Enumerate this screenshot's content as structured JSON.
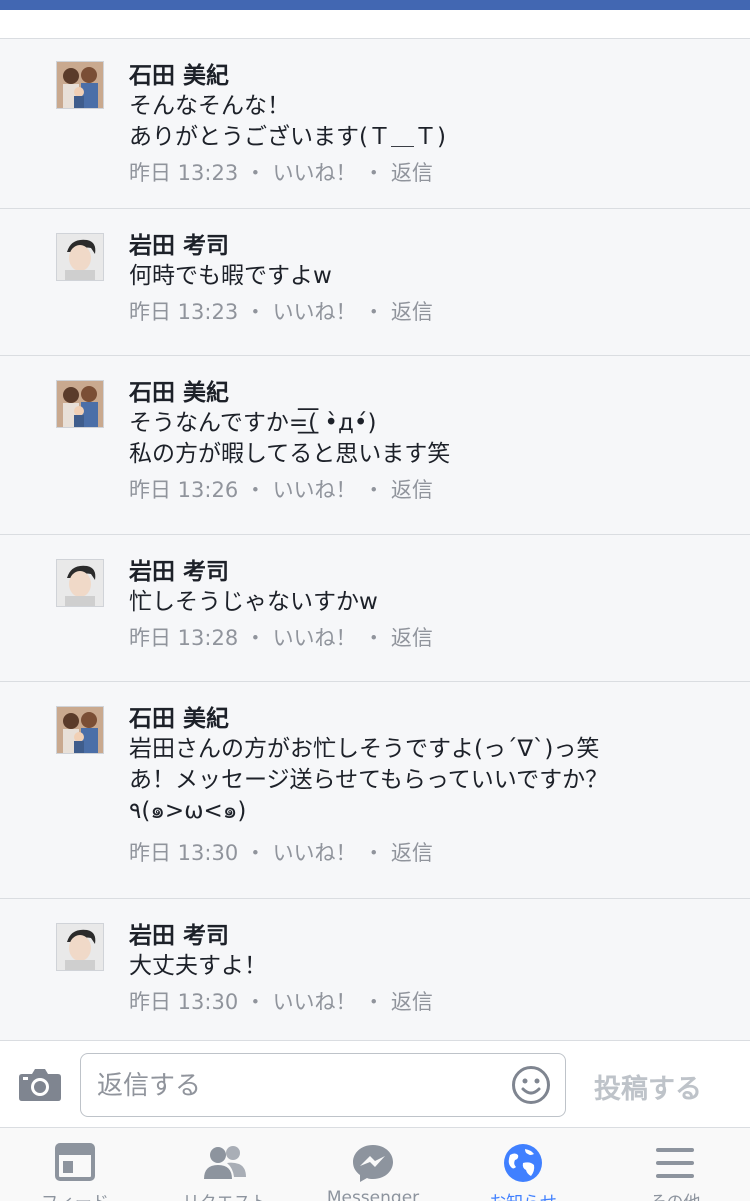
{
  "comments": [
    {
      "name": "石田 美紀",
      "text": "そんなそんな！\nありがとうございます(Ｔ＿Ｔ)",
      "time": "昨日 13:23",
      "like": "いいね！",
      "reply": "返信",
      "avatar": "couple"
    },
    {
      "name": "岩田 考司",
      "text": "何時でも暇ですよw",
      "time": "昨日 13:23",
      "like": "いいね！",
      "reply": "返信",
      "avatar": "man"
    },
    {
      "name": "石田 美紀",
      "text": "そうなんですか=͟͟͞͞( •̀д•́)\n私の方が暇してると思います笑",
      "time": "昨日 13:26",
      "like": "いいね！",
      "reply": "返信",
      "avatar": "couple"
    },
    {
      "name": "岩田 考司",
      "text": "忙しそうじゃないすかw",
      "time": "昨日 13:28",
      "like": "いいね！",
      "reply": "返信",
      "avatar": "man"
    },
    {
      "name": "石田 美紀",
      "text": "岩田さんの方がお忙しそうですよ(っ´∇`)っ笑\nあ！メッセージ送らせてもらっていいですか？\n٩(๑>ω<๑)",
      "time": "昨日 13:30",
      "like": "いいね！",
      "reply": "返信",
      "avatar": "couple"
    },
    {
      "name": "岩田 考司",
      "text": "大丈夫すよ！",
      "time": "昨日 13:30",
      "like": "いいね！",
      "reply": "返信",
      "avatar": "man"
    }
  ],
  "composer": {
    "placeholder": "返信する",
    "post_label": "投稿する",
    "camera_icon": "camera-icon",
    "emoji_icon": "smiley-icon"
  },
  "tabs": [
    {
      "label": "フィード",
      "icon": "news-feed-icon",
      "active": false
    },
    {
      "label": "リクエスト",
      "icon": "friend-requests-icon",
      "active": false
    },
    {
      "label": "Messenger",
      "icon": "messenger-icon",
      "active": false
    },
    {
      "label": "お知らせ",
      "icon": "globe-notifications-icon",
      "active": true
    },
    {
      "label": "その他",
      "icon": "menu-icon",
      "active": false
    }
  ],
  "colors": {
    "brand": "#4267b2",
    "active_tab": "#4080ff",
    "meta_text": "#90949c"
  }
}
